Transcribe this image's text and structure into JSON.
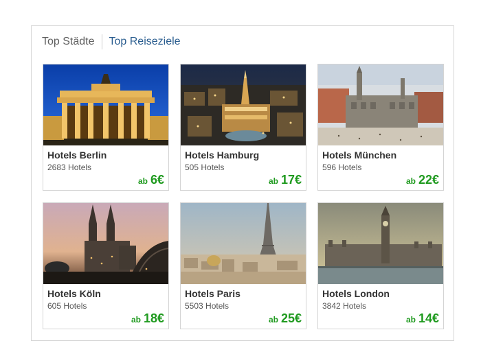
{
  "tabs": {
    "top_staedte": "Top Städte",
    "top_reiseziele": "Top Reiseziele"
  },
  "cards": [
    {
      "title": "Hotels Berlin",
      "count": "2683 Hotels",
      "price_prefix": "ab",
      "price": "6€",
      "image": "brandenburg-gate-icon"
    },
    {
      "title": "Hotels Hamburg",
      "count": "505 Hotels",
      "price_prefix": "ab",
      "price": "17€",
      "image": "hamburg-city-hall-night-icon"
    },
    {
      "title": "Hotels München",
      "count": "596 Hotels",
      "price_prefix": "ab",
      "price": "22€",
      "image": "munich-marienplatz-icon"
    },
    {
      "title": "Hotels Köln",
      "count": "605 Hotels",
      "price_prefix": "ab",
      "price": "18€",
      "image": "cologne-cathedral-icon"
    },
    {
      "title": "Hotels Paris",
      "count": "5503 Hotels",
      "price_prefix": "ab",
      "price": "25€",
      "image": "eiffel-tower-icon"
    },
    {
      "title": "Hotels London",
      "count": "3842 Hotels",
      "price_prefix": "ab",
      "price": "14€",
      "image": "big-ben-icon"
    }
  ],
  "colors": {
    "price_green": "#1f9a1f",
    "active_tab_blue": "#2a5d8f"
  }
}
